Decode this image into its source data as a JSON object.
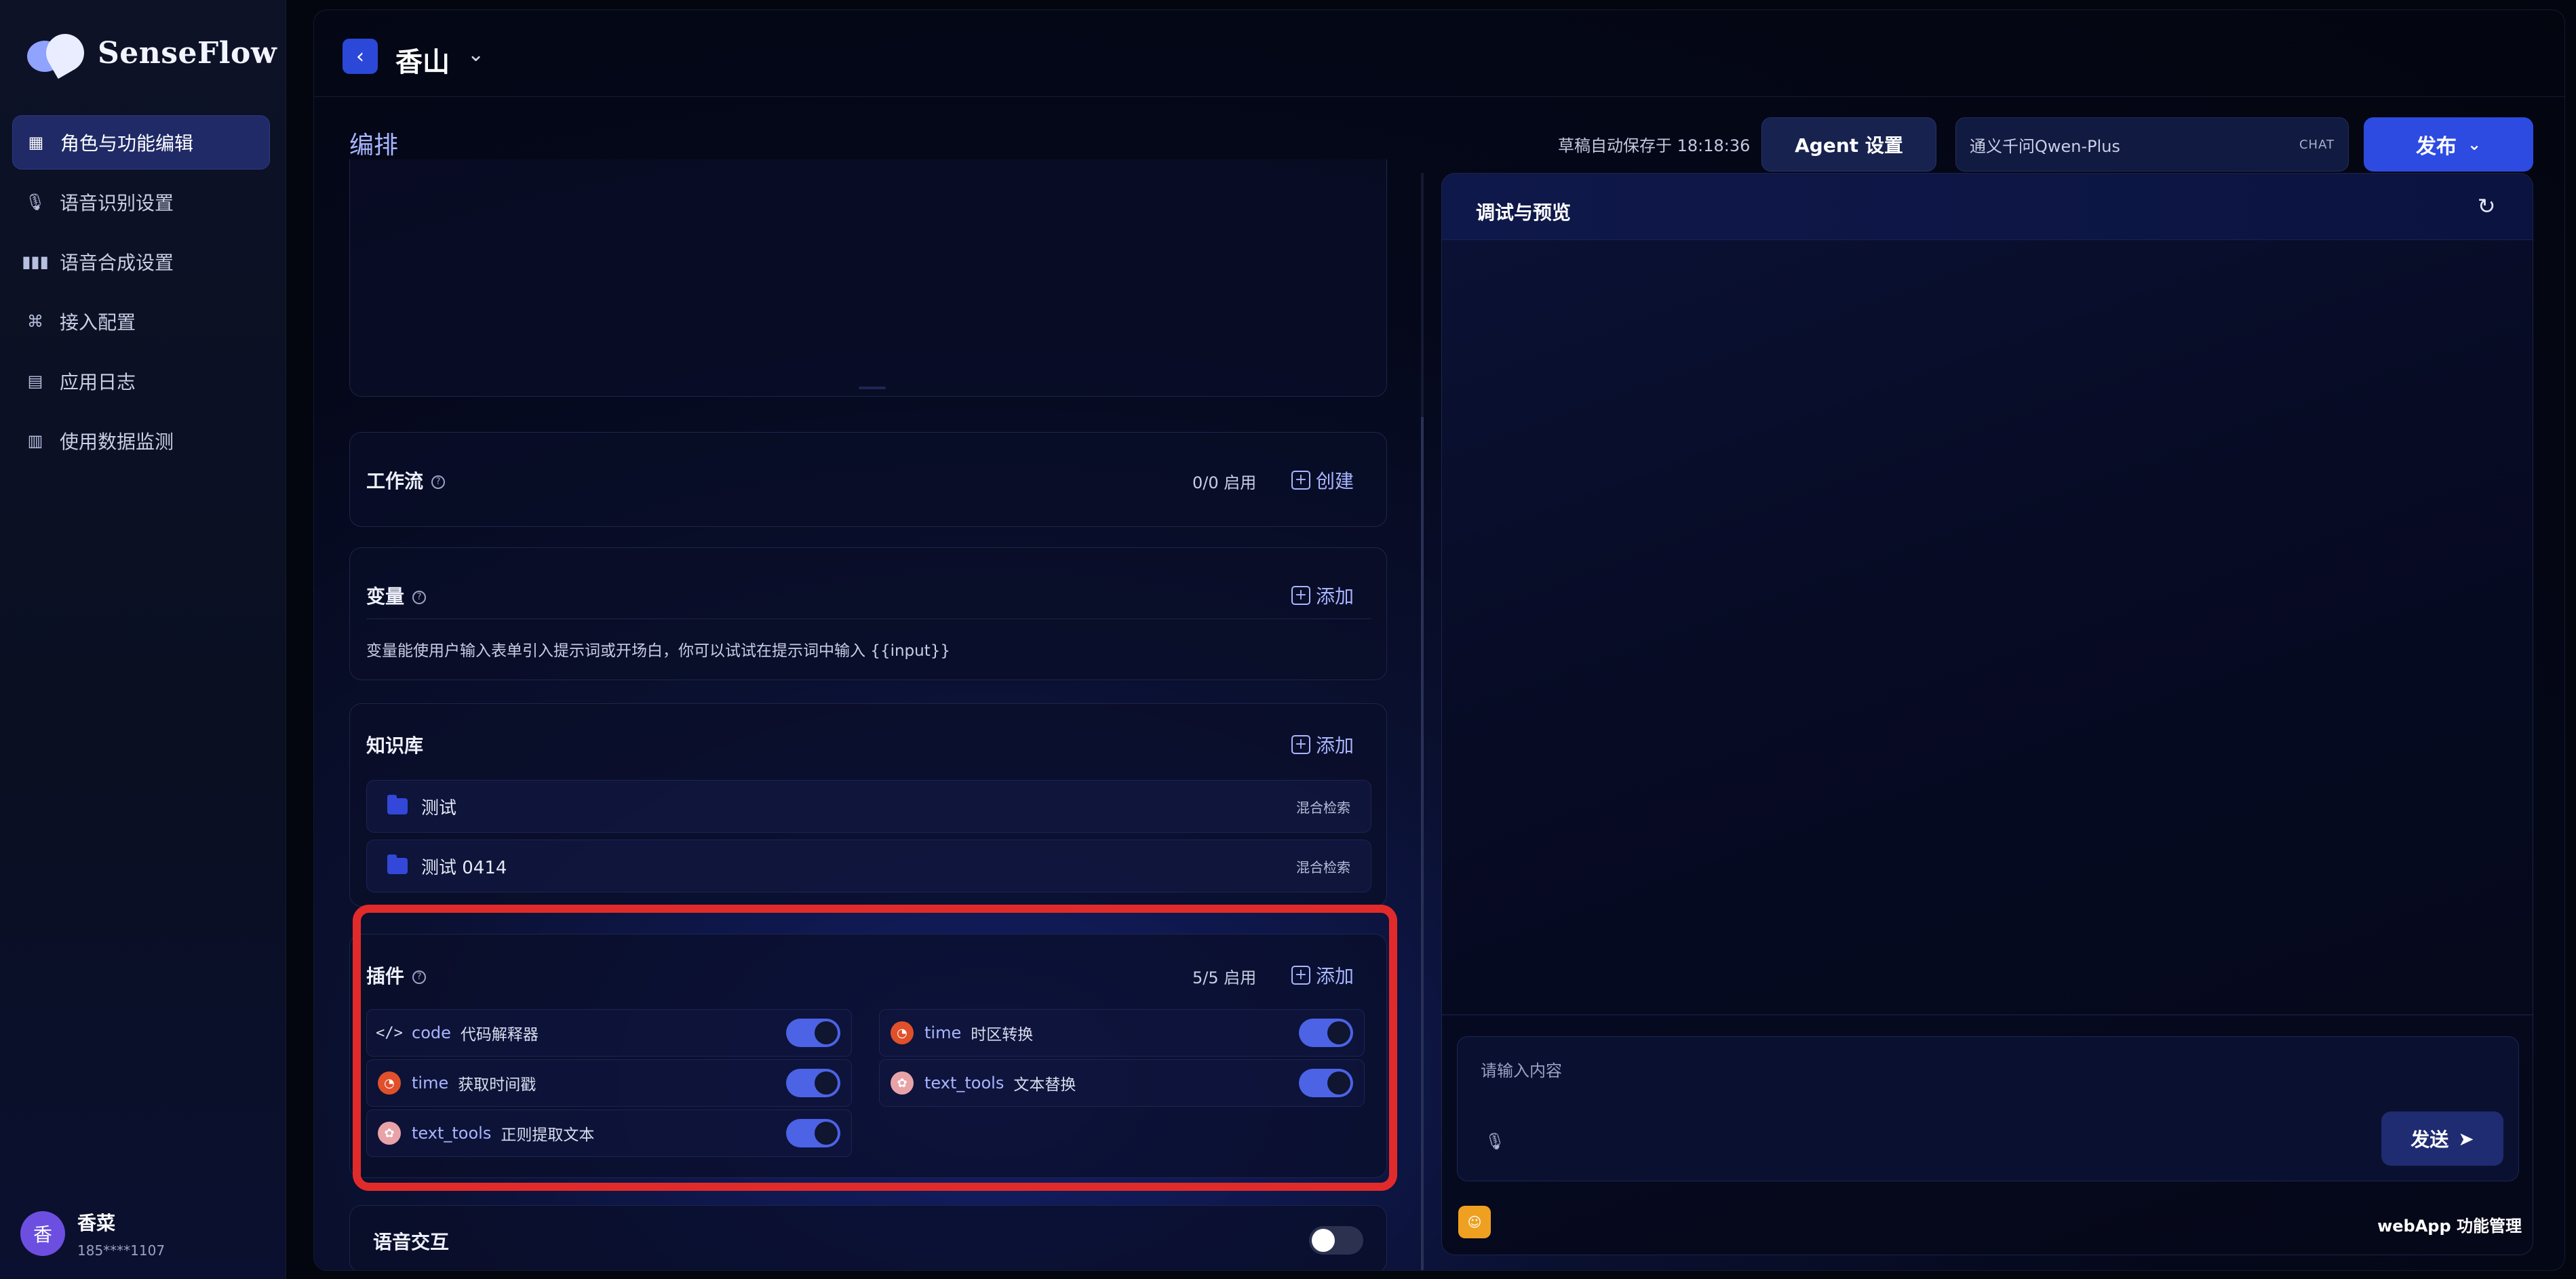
{
  "brand": {
    "name": "SenseFlow"
  },
  "sidebar": {
    "items": [
      {
        "label": "角色与功能编辑",
        "icon": "grid-edit-icon",
        "active": true
      },
      {
        "label": "语音识别设置",
        "icon": "microphone-icon",
        "active": false
      },
      {
        "label": "语音合成设置",
        "icon": "waveform-icon",
        "active": false
      },
      {
        "label": "接入配置",
        "icon": "command-icon",
        "active": false
      },
      {
        "label": "应用日志",
        "icon": "clipboard-icon",
        "active": false
      },
      {
        "label": "使用数据监测",
        "icon": "chart-icon",
        "active": false
      }
    ]
  },
  "user": {
    "avatar_text": "香",
    "name": "香菜",
    "phone": "185****1107"
  },
  "header": {
    "app_title": "香山",
    "section_title": "编排",
    "autosave": "草稿自动保存于 18:18:36",
    "agent_button": "Agent 设置",
    "model_name": "通义千问Qwen-Plus",
    "model_tag": "CHAT",
    "publish_button": "发布"
  },
  "workflow": {
    "title": "工作流",
    "stat": "0/0 启用",
    "action": "创建"
  },
  "variables": {
    "title": "变量",
    "action": "添加",
    "description": "变量能使用户输入表单引入提示词或开场白，你可以试试在提示词中输入 {{input}}"
  },
  "knowledge": {
    "title": "知识库",
    "action": "添加",
    "items": [
      {
        "name": "测试",
        "tag": "混合检索"
      },
      {
        "name": "测试 0414",
        "tag": "混合检索"
      }
    ]
  },
  "plugins": {
    "title": "插件",
    "stat": "5/5 启用",
    "action": "添加",
    "items": [
      {
        "name": "code",
        "desc": "代码解释器",
        "icon": "code-icon",
        "enabled": true
      },
      {
        "name": "time",
        "desc": "时区转换",
        "icon": "clock-icon",
        "enabled": true
      },
      {
        "name": "time",
        "desc": "获取时间戳",
        "icon": "clock-icon",
        "enabled": true
      },
      {
        "name": "text_tools",
        "desc": "文本替换",
        "icon": "text-tools-icon",
        "enabled": true
      },
      {
        "name": "text_tools",
        "desc": "正则提取文本",
        "icon": "text-tools-icon",
        "enabled": true
      }
    ]
  },
  "voice": {
    "title": "语音交互",
    "enabled": false
  },
  "preview": {
    "title": "调试与预览",
    "input_placeholder": "请输入内容",
    "send_button": "发送",
    "webapp_label": "webApp 功能管理"
  },
  "colors": {
    "accent": "#2d4be0",
    "highlight": "#e12b2b",
    "toggle_on": "#4c63e6"
  }
}
